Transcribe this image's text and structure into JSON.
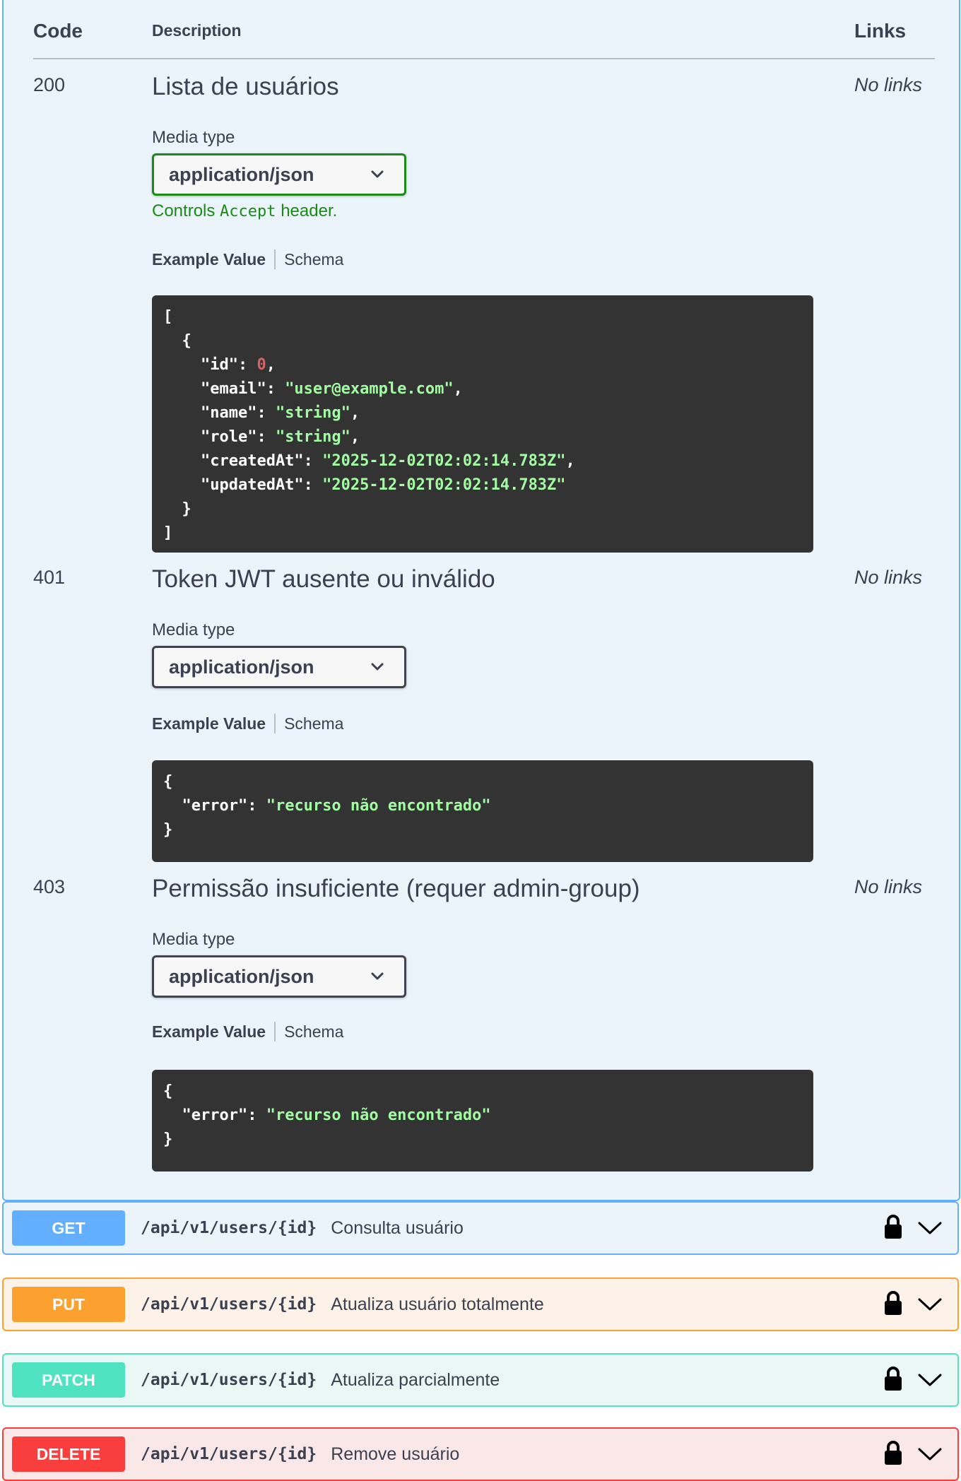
{
  "table": {
    "header": {
      "code": "Code",
      "description": "Description",
      "links": "Links"
    }
  },
  "responses": [
    {
      "code": "200",
      "description": "Lista de usuários",
      "links": "No links",
      "media_label": "Media type",
      "media_value": "application/json",
      "controls_prefix": "Controls",
      "controls_code": "Accept",
      "controls_suffix": "header.",
      "tab_example": "Example Value",
      "tab_schema": "Schema",
      "example_lines": [
        "[",
        "  {",
        "    \"id\": 0,",
        "    \"email\": \"user@example.com\",",
        "    \"name\": \"string\",",
        "    \"role\": \"string\",",
        "    \"createdAt\": \"2025-12-02T02:02:14.783Z\",",
        "    \"updatedAt\": \"2025-12-02T02:02:14.783Z\"",
        "  }",
        "]"
      ]
    },
    {
      "code": "401",
      "description": "Token JWT ausente ou inválido",
      "links": "No links",
      "media_label": "Media type",
      "media_value": "application/json",
      "tab_example": "Example Value",
      "tab_schema": "Schema",
      "example_lines": [
        "{",
        "  \"error\": \"recurso não encontrado\"",
        "}"
      ]
    },
    {
      "code": "403",
      "description": "Permissão insuficiente (requer admin-group)",
      "links": "No links",
      "media_label": "Media type",
      "media_value": "application/json",
      "tab_example": "Example Value",
      "tab_schema": "Schema",
      "example_lines": [
        "{",
        "  \"error\": \"recurso não encontrado\"",
        "}"
      ]
    }
  ],
  "operations": [
    {
      "method": "GET",
      "path": "/api/v1/users/{id}",
      "summary": "Consulta usuário",
      "color": "#61affe"
    },
    {
      "method": "PUT",
      "path": "/api/v1/users/{id}",
      "summary": "Atualiza usuário totalmente",
      "color": "#fca130"
    },
    {
      "method": "PATCH",
      "path": "/api/v1/users/{id}",
      "summary": "Atualiza parcialmente",
      "color": "#50e3c2"
    },
    {
      "method": "DELETE",
      "path": "/api/v1/users/{id}",
      "summary": "Remove usuário",
      "color": "#f93e3e"
    }
  ],
  "icons": {
    "lock": "lock-icon",
    "chevron": "chevron-down-icon",
    "select_chevron": "chevron-down-icon"
  },
  "colors": {
    "code_bg": "#333333",
    "string": "#a2fca2",
    "number": "#d36363",
    "accept_border": "#1b8a16"
  }
}
